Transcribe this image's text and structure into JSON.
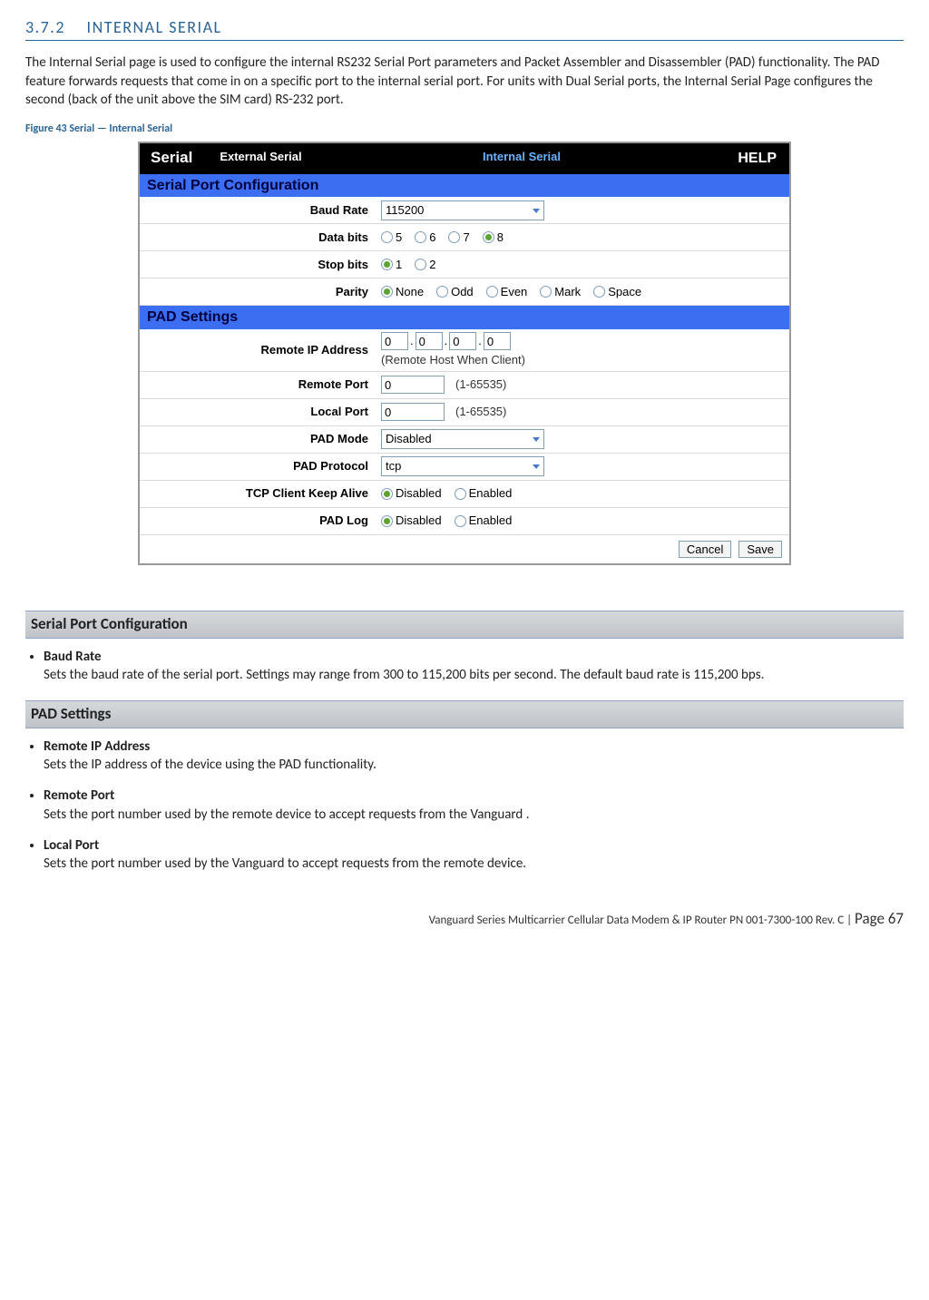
{
  "heading": {
    "num": "3.7.2",
    "title": "INTERNAL SERIAL"
  },
  "intro": "The Internal Serial page is used to configure the internal RS232 Serial Port parameters and Packet Assembler and Disassembler (PAD) functionality. The PAD feature forwards requests that come in on a specific port to the internal serial port. For units with Dual Serial ports, the Internal Serial Page configures the second (back of the unit above the SIM card) RS-232 port.",
  "figure_caption": "Figure 43 Serial — Internal Serial",
  "screenshot": {
    "title": "Serial",
    "tab_external": "External Serial",
    "tab_internal": "Internal Serial",
    "help": "HELP",
    "section1": "Serial Port Configuration",
    "baud_rate_label": "Baud Rate",
    "baud_rate_value": "115200",
    "data_bits_label": "Data bits",
    "data_bits_options": [
      "5",
      "6",
      "7",
      "8"
    ],
    "data_bits_selected": "8",
    "stop_bits_label": "Stop bits",
    "stop_bits_options": [
      "1",
      "2"
    ],
    "stop_bits_selected": "1",
    "parity_label": "Parity",
    "parity_options": [
      "None",
      "Odd",
      "Even",
      "Mark",
      "Space"
    ],
    "parity_selected": "None",
    "section2": "PAD Settings",
    "remote_ip_label": "Remote IP Address",
    "remote_ip_values": [
      "0",
      "0",
      "0",
      "0"
    ],
    "remote_ip_hint": "(Remote Host When Client)",
    "remote_port_label": "Remote Port",
    "remote_port_value": "0",
    "port_hint": "(1-65535)",
    "local_port_label": "Local Port",
    "local_port_value": "0",
    "pad_mode_label": "PAD Mode",
    "pad_mode_value": "Disabled",
    "pad_protocol_label": "PAD Protocol",
    "pad_protocol_value": "tcp",
    "tcp_keepalive_label": "TCP Client Keep Alive",
    "tcp_keepalive_options": [
      "Disabled",
      "Enabled"
    ],
    "tcp_keepalive_selected": "Disabled",
    "pad_log_label": "PAD Log",
    "pad_log_options": [
      "Disabled",
      "Enabled"
    ],
    "pad_log_selected": "Disabled",
    "btn_cancel": "Cancel",
    "btn_save": "Save"
  },
  "serial_port_config": {
    "header": "Serial Port Configuration",
    "items": [
      {
        "term": "Baud Rate",
        "def": "Sets the baud rate of the serial port. Settings may range from 300 to 115,200 bits per second. The default baud rate is 115,200 bps."
      }
    ]
  },
  "pad_settings": {
    "header": "PAD Settings",
    "items": [
      {
        "term": "Remote IP Address",
        "def": "Sets the IP address of the device using the PAD functionality."
      },
      {
        "term": "Remote Port",
        "def": "Sets the port number used by the remote device to accept requests from the Vanguard ."
      },
      {
        "term": "Local Port",
        "def": "Sets the port number used by the Vanguard to accept requests from the remote device."
      }
    ]
  },
  "footer": {
    "text": "Vanguard Series Multicarrier Cellular Data Modem & IP Router PN 001-7300-100 Rev. C",
    "page_label": "Page 67"
  }
}
